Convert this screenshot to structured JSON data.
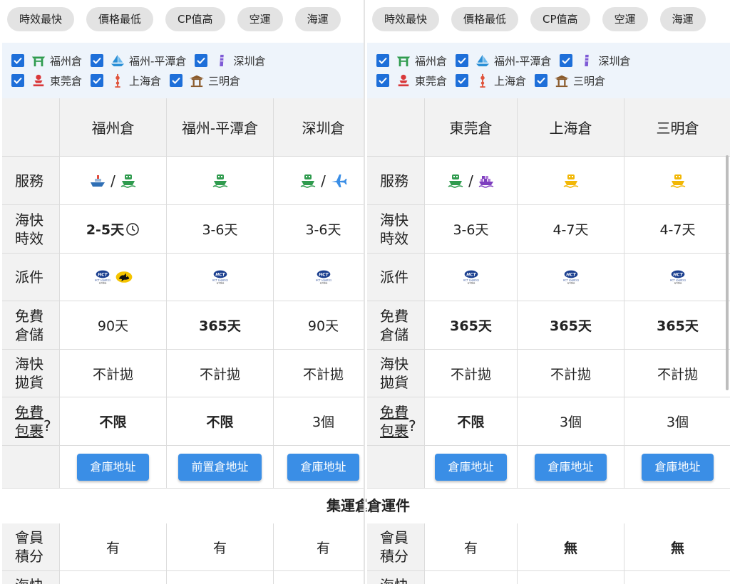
{
  "sort_chips": [
    "時效最快",
    "價格最低",
    "CP值高",
    "空運",
    "海運"
  ],
  "filters": [
    {
      "label": "福州倉",
      "icon": "fuzhou-gate-icon",
      "color": "#2f9b4e",
      "checked": true
    },
    {
      "label": "福州-平潭倉",
      "icon": "pingtan-sail-icon",
      "color": "#2a8fd6",
      "checked": true
    },
    {
      "label": "深圳倉",
      "icon": "shenzhen-tower-icon",
      "color": "#7e5bd6",
      "checked": true
    },
    {
      "label": "東莞倉",
      "icon": "dongguan-monument-icon",
      "color": "#d9383a",
      "checked": true
    },
    {
      "label": "上海倉",
      "icon": "shanghai-tower-icon",
      "color": "#e0533b",
      "checked": true
    },
    {
      "label": "三明倉",
      "icon": "sanming-pavilion-icon",
      "color": "#8a5a2b",
      "checked": true
    }
  ],
  "row_labels": {
    "service": "服務",
    "speed": "海快\n時效",
    "delivery": "派件",
    "storage": "免費\n倉儲",
    "bulk": "海快\n拋貨",
    "parcels": "免費\n包裹",
    "parcels_q": "?",
    "points": "會員\n積分",
    "partial": "海快"
  },
  "section_title": "集運倉運件",
  "left_panel": {
    "columns": [
      {
        "name": "福州倉",
        "services": [
          "ship-blue-icon",
          "ship-green-icon"
        ],
        "speed": "2-5天",
        "speed_bold": true,
        "speed_clock": true,
        "delivery": [
          "hct-logo",
          "black-cat-logo"
        ],
        "storage": "90天",
        "storage_bold": false,
        "bulk": "不計拋",
        "parcels": "不限",
        "parcels_bold": true,
        "button": "倉庫地址",
        "points": "有",
        "points_bold": false
      },
      {
        "name": "福州-平潭倉",
        "services": [
          "ship-green-icon"
        ],
        "speed": "3-6天",
        "speed_bold": false,
        "speed_clock": false,
        "delivery": [
          "hct-logo"
        ],
        "storage": "365天",
        "storage_bold": true,
        "bulk": "不計拋",
        "parcels": "不限",
        "parcels_bold": true,
        "button": "前置倉地址",
        "points": "有",
        "points_bold": false
      },
      {
        "name": "深圳倉",
        "services": [
          "ship-green-icon",
          "plane-icon"
        ],
        "speed": "3-6天",
        "speed_bold": false,
        "speed_clock": false,
        "delivery": [
          "hct-logo"
        ],
        "storage": "90天",
        "storage_bold": false,
        "bulk": "不計拋",
        "parcels": "3個",
        "parcels_bold": false,
        "button": "倉庫地址",
        "points": "有",
        "points_bold": false
      }
    ]
  },
  "right_panel": {
    "columns": [
      {
        "name": "東莞倉",
        "services": [
          "ship-green-icon",
          "cargo-ship-icon"
        ],
        "speed": "3-6天",
        "speed_bold": false,
        "speed_clock": false,
        "delivery": [
          "hct-logo"
        ],
        "storage": "365天",
        "storage_bold": true,
        "bulk": "不計拋",
        "parcels": "不限",
        "parcels_bold": true,
        "button": "倉庫地址",
        "points": "有",
        "points_bold": false
      },
      {
        "name": "上海倉",
        "services": [
          "ship-yellow-icon"
        ],
        "speed": "4-7天",
        "speed_bold": false,
        "speed_clock": false,
        "delivery": [
          "hct-logo"
        ],
        "storage": "365天",
        "storage_bold": true,
        "bulk": "不計拋",
        "parcels": "3個",
        "parcels_bold": false,
        "button": "倉庫地址",
        "points": "無",
        "points_bold": true
      },
      {
        "name": "三明倉",
        "services": [
          "ship-yellow-icon"
        ],
        "speed": "4-7天",
        "speed_bold": false,
        "speed_clock": false,
        "delivery": [
          "hct-logo"
        ],
        "storage": "365天",
        "storage_bold": true,
        "bulk": "不計拋",
        "parcels": "3個",
        "parcels_bold": false,
        "button": "倉庫地址",
        "points": "無",
        "points_bold": true
      }
    ]
  },
  "hct_text": {
    "mark": "HCT",
    "sub": "HCT Logistics",
    "sub2": "新竹物流"
  },
  "colors": {
    "accent_button": "#3a8ee6",
    "checkbox": "#1e6fd9",
    "ship_green": "#2f9b4e",
    "ship_yellow": "#f2b705",
    "ship_blue": "#2f6fb5",
    "plane": "#3a8ee6",
    "cargo": "#7e3fbf"
  }
}
